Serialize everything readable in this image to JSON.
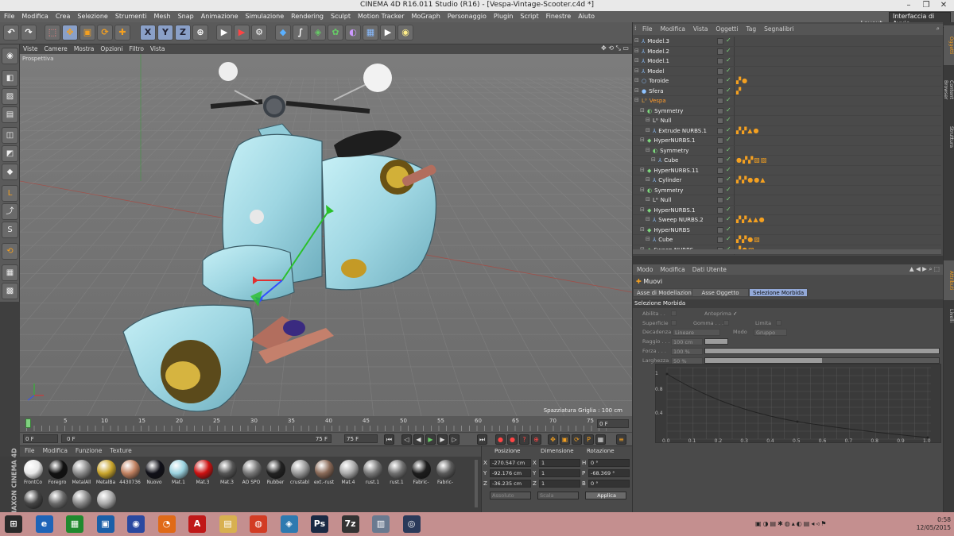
{
  "window": {
    "title": "CINEMA 4D R16.011 Studio (R16) - [Vespa-Vintage-Scooter.c4d *]"
  },
  "menubar": {
    "items": [
      "File",
      "Modifica",
      "Crea",
      "Selezione",
      "Strumenti",
      "Mesh",
      "Snap",
      "Animazione",
      "Simulazione",
      "Rendering",
      "Sculpt",
      "Motion Tracker",
      "MoGraph",
      "Personaggio",
      "Plugin",
      "Script",
      "Finestre",
      "Aiuto"
    ],
    "layout_label": "Layout:",
    "layout_value": "Interfaccia di Avvio"
  },
  "viewport": {
    "menu": [
      "Viste",
      "Camere",
      "Mostra",
      "Opzioni",
      "Filtro",
      "Vista"
    ],
    "label": "Prospettiva",
    "grid_spacing": "Spazziatura Griglia : 100 cm"
  },
  "timeline": {
    "ticks": [
      "0",
      "5",
      "10",
      "15",
      "20",
      "25",
      "30",
      "35",
      "40",
      "45",
      "50",
      "55",
      "60",
      "65",
      "70",
      "75"
    ],
    "end_label": "0 F",
    "current_frame": "0 F",
    "min_frame": "0 F",
    "max_frame": "75 F",
    "end_frame": "75 F"
  },
  "material_manager": {
    "menu": [
      "File",
      "Modifica",
      "Funzione",
      "Texture"
    ],
    "materials": [
      {
        "name": "FrontCo",
        "color": "#e8e8e8"
      },
      {
        "name": "Foregro",
        "color": "#111111"
      },
      {
        "name": "MetalAll",
        "color": "#8c8c8c"
      },
      {
        "name": "MetalBa",
        "color": "#c9a52c"
      },
      {
        "name": "4430736",
        "color": "#c08060"
      },
      {
        "name": "Nuovo",
        "color": "#101018"
      },
      {
        "name": "Mat.1",
        "color": "#9ad2df"
      },
      {
        "name": "Mat.3",
        "color": "#cc1111"
      },
      {
        "name": "Mat.3",
        "color": "#555555"
      },
      {
        "name": "AO SPO",
        "color": "#777777"
      },
      {
        "name": "Rubber",
        "color": "#222222"
      },
      {
        "name": "crustabl",
        "color": "#999999"
      },
      {
        "name": "ext.-rust",
        "color": "#8a6a58"
      },
      {
        "name": "Mat.4",
        "color": "#aaaaaa"
      },
      {
        "name": "rust.1",
        "color": "#777777"
      },
      {
        "name": "rust.1",
        "color": "#6f6f6f"
      },
      {
        "name": "Fabric-",
        "color": "#1c1c1c"
      },
      {
        "name": "Fabric-",
        "color": "#5a5a5a"
      }
    ],
    "row2_colors": [
      "#444444",
      "#6a6a6a",
      "#888888",
      "#aaaaaa"
    ]
  },
  "coordinates": {
    "headers": [
      "Posizione",
      "Dimensione",
      "Rotazione"
    ],
    "rows": [
      {
        "axis": "X",
        "pos": "-270.547 cm",
        "dim_axis": "X",
        "dim": "1",
        "rot_axis": "H",
        "rot": "0 °"
      },
      {
        "axis": "Y",
        "pos": "-92.176 cm",
        "dim_axis": "Y",
        "dim": "1",
        "rot_axis": "P",
        "rot": "-68.369 °"
      },
      {
        "axis": "Z",
        "pos": "-36.235 cm",
        "dim_axis": "Z",
        "dim": "1",
        "rot_axis": "B",
        "rot": "0 °"
      }
    ],
    "mode1": "Assoluto",
    "mode2": "Scala",
    "apply": "Applica"
  },
  "object_manager": {
    "menu": [
      "File",
      "Modifica",
      "Vista",
      "Oggetti",
      "Tag",
      "Segnalibri"
    ],
    "objects": [
      {
        "name": "Model.3",
        "indent": 0,
        "icon": "⅄",
        "icolor": "#8fc3ff",
        "ncolor": "#eeeeee",
        "tags": ""
      },
      {
        "name": "Model.2",
        "indent": 0,
        "icon": "⅄",
        "icolor": "#8fc3ff",
        "ncolor": "#eeeeee",
        "tags": ""
      },
      {
        "name": "Model.1",
        "indent": 0,
        "icon": "⅄",
        "icolor": "#8fc3ff",
        "ncolor": "#eeeeee",
        "tags": ""
      },
      {
        "name": "Model",
        "indent": 0,
        "icon": "⅄",
        "icolor": "#8fc3ff",
        "ncolor": "#eeeeee",
        "tags": ""
      },
      {
        "name": "Toroide",
        "indent": 0,
        "icon": "○",
        "icolor": "#8fc3ff",
        "ncolor": "#eeeeee",
        "tags": "▞●"
      },
      {
        "name": "Sfera",
        "indent": 0,
        "icon": "●",
        "icolor": "#8fc3ff",
        "ncolor": "#eeeeee",
        "tags": "▞"
      },
      {
        "name": "Vespa",
        "indent": 0,
        "icon": "L⁰",
        "icolor": "#e0a040",
        "ncolor": "#ff9a2a",
        "tags": ""
      },
      {
        "name": "Symmetry",
        "indent": 1,
        "icon": "◐",
        "icolor": "#7cd87c",
        "ncolor": "#eeeeee",
        "tags": ""
      },
      {
        "name": "Null",
        "indent": 2,
        "icon": "L⁰",
        "icolor": "#e0e0e0",
        "ncolor": "#eeeeee",
        "tags": ""
      },
      {
        "name": "Extrude NURBS.1",
        "indent": 2,
        "icon": "⅄",
        "icolor": "#8fc3ff",
        "ncolor": "#eeeeee",
        "tags": "▞▞▲●"
      },
      {
        "name": "HyperNURBS.1",
        "indent": 1,
        "icon": "◆",
        "icolor": "#7cd87c",
        "ncolor": "#eeeeee",
        "tags": ""
      },
      {
        "name": "Symmetry",
        "indent": 2,
        "icon": "◐",
        "icolor": "#7cd87c",
        "ncolor": "#eeeeee",
        "tags": ""
      },
      {
        "name": "Cube",
        "indent": 3,
        "icon": "⅄",
        "icolor": "#8fc3ff",
        "ncolor": "#eeeeee",
        "tags": "●▞▞▨▨"
      },
      {
        "name": "HyperNURBS.11",
        "indent": 1,
        "icon": "◆",
        "icolor": "#7cd87c",
        "ncolor": "#eeeeee",
        "tags": ""
      },
      {
        "name": "Cylinder",
        "indent": 2,
        "icon": "⅄",
        "icolor": "#8fc3ff",
        "ncolor": "#eeeeee",
        "tags": "▞▞●●▲"
      },
      {
        "name": "Symmetry",
        "indent": 1,
        "icon": "◐",
        "icolor": "#7cd87c",
        "ncolor": "#eeeeee",
        "tags": ""
      },
      {
        "name": "Null",
        "indent": 2,
        "icon": "L⁰",
        "icolor": "#e0e0e0",
        "ncolor": "#eeeeee",
        "tags": ""
      },
      {
        "name": "HyperNURBS.1",
        "indent": 1,
        "icon": "◆",
        "icolor": "#7cd87c",
        "ncolor": "#eeeeee",
        "tags": ""
      },
      {
        "name": "Sweep NURBS.2",
        "indent": 2,
        "icon": "⅄",
        "icolor": "#8fc3ff",
        "ncolor": "#eeeeee",
        "tags": "▞▞▲▲●"
      },
      {
        "name": "HyperNURBS",
        "indent": 1,
        "icon": "◆",
        "icolor": "#7cd87c",
        "ncolor": "#eeeeee",
        "tags": ""
      },
      {
        "name": "Cube",
        "indent": 2,
        "icon": "⅄",
        "icolor": "#8fc3ff",
        "ncolor": "#eeeeee",
        "tags": "▞▞●▨"
      },
      {
        "name": "Sweep NURBS",
        "indent": 1,
        "icon": "◆",
        "icolor": "#7cd87c",
        "ncolor": "#eeeeee",
        "tags": "▞●▨"
      }
    ]
  },
  "attributes": {
    "menu": [
      "Modo",
      "Modifica",
      "Dati Utente"
    ],
    "title": "Muovi",
    "tabs": [
      "Asse di Modellazione",
      "Asse Oggetto",
      "Selezione Morbida"
    ],
    "active_tab": "Selezione Morbida",
    "section": "Selezione Morbida",
    "abilita": "Abilita . .",
    "anteprima": "Anteprima",
    "superficie": "Superficie",
    "gomma": "Gomma . . .",
    "limita": "Limita",
    "decadenza": "Decadenza",
    "decadenza_value": "Lineare",
    "modo": "Modo",
    "modo_value": "Gruppo",
    "raggio": "Raggio . . .",
    "raggio_value": "100 cm",
    "forza": "Forza . . .",
    "forza_value": "100 %",
    "forza_level": 1.0,
    "larghezza": "Larghezza",
    "larghezza_value": "50 %",
    "larghezza_level": 0.5,
    "curve_y": [
      "1",
      "0.8",
      "0.4"
    ],
    "curve_x": [
      "0.0",
      "0.1",
      "0.2",
      "0.3",
      "0.4",
      "0.5",
      "0.6",
      "0.7",
      "0.8",
      "0.9",
      "1.0"
    ]
  },
  "side_tabs": [
    "Oggetti",
    "Content Browser",
    "Struttura",
    "Attributi",
    "Livelli"
  ],
  "taskbar": {
    "apps": [
      "⊞",
      "e",
      "▦",
      "▣",
      "◉",
      "◔",
      "A",
      "▤",
      "◍",
      "◈",
      "Ps",
      "7z",
      "▥",
      "◎"
    ],
    "time": "0:58",
    "date": "12/05/2015"
  }
}
